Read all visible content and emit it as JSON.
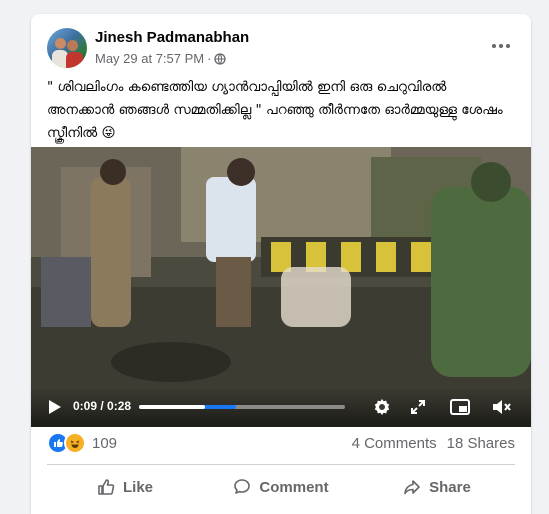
{
  "post": {
    "author": "Jinesh Padmanabhan",
    "timestamp": "May 29 at 7:57 PM",
    "separator": "·",
    "privacy_icon": "globe-icon",
    "text": "\" ശിവലിംഗം കണ്ടെത്തിയ ഗ്യാൻവാപ്പിയിൽ ഇനി ഒരു ചെറുവിരൽ അനക്കാൻ ഞങ്ങൾ സമ്മതിക്കില്ല \" പറഞ്ഞു തീർന്നതേ ഓർമ്മയുള്ളു ശേഷം സ്ക്രീനിൽ",
    "emoji": "😜"
  },
  "video": {
    "current_time": "0:09",
    "time_separator": " / ",
    "duration": "0:28",
    "progress_fraction": 0.32,
    "buffered_fraction": 0.47,
    "accent_color": "#1877f2"
  },
  "stats": {
    "reaction_count": "109",
    "comments": "4 Comments",
    "shares": "18 Shares"
  },
  "actions": {
    "like": "Like",
    "comment": "Comment",
    "share": "Share"
  },
  "colors": {
    "facebook_blue": "#1877f2",
    "secondary_text": "#65676b"
  }
}
